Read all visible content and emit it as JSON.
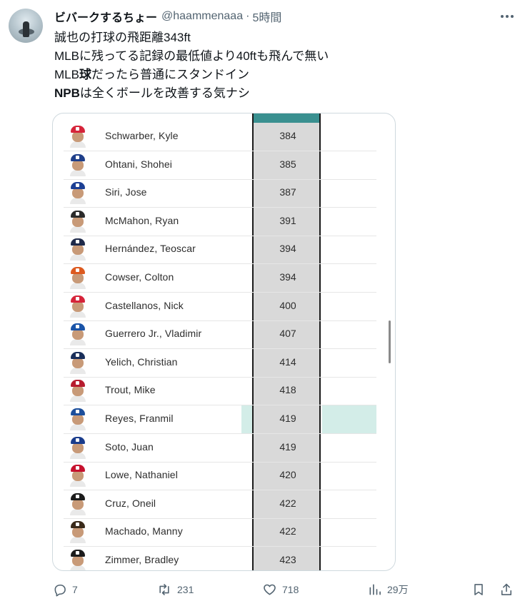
{
  "user": {
    "name": "ビバークするちょー",
    "handle": "@haammenaaa",
    "separator": "·",
    "time": "5時間"
  },
  "tweet": {
    "lines": [
      {
        "text": "誠也の打球の飛距離343ft"
      },
      {
        "text": "MLBに残ってる記録の最低値より40ftも飛んで無い"
      },
      {
        "pre": "MLB",
        "bold": "球",
        "post": "だったら普通にスタンドイン"
      },
      {
        "bold": "NPB",
        "post": "は全くボールを改善する気ナシ"
      }
    ]
  },
  "table": {
    "rows": [
      {
        "name": "Schwarber, Kyle",
        "value": "384",
        "cap": "#d6243a"
      },
      {
        "name": "Ohtani, Shohei",
        "value": "385",
        "cap": "#1f3f8a"
      },
      {
        "name": "Siri, Jose",
        "value": "387",
        "cap": "#1c3f94"
      },
      {
        "name": "McMahon, Ryan",
        "value": "391",
        "cap": "#2b2b2b"
      },
      {
        "name": "Hernández, Teoscar",
        "value": "394",
        "cap": "#1f2a4a"
      },
      {
        "name": "Cowser, Colton",
        "value": "394",
        "cap": "#dd5a1f"
      },
      {
        "name": "Castellanos, Nick",
        "value": "400",
        "cap": "#d6243a"
      },
      {
        "name": "Guerrero Jr., Vladimir",
        "value": "407",
        "cap": "#1a54a8"
      },
      {
        "name": "Yelich, Christian",
        "value": "414",
        "cap": "#1a2f5a"
      },
      {
        "name": "Trout, Mike",
        "value": "418",
        "cap": "#b71c2e"
      },
      {
        "name": "Reyes, Franmil",
        "value": "419",
        "cap": "#1d4f9c",
        "highlighted": true
      },
      {
        "name": "Soto, Juan",
        "value": "419",
        "cap": "#1a3c8c"
      },
      {
        "name": "Lowe, Nathaniel",
        "value": "420",
        "cap": "#c6112e"
      },
      {
        "name": "Cruz, Oneil",
        "value": "422",
        "cap": "#1c1c1c"
      },
      {
        "name": "Machado, Manny",
        "value": "422",
        "cap": "#3a2a1a"
      },
      {
        "name": "Zimmer, Bradley",
        "value": "423",
        "cap": "#1c1c1c"
      }
    ]
  },
  "actions": {
    "reply": {
      "icon": "reply-icon",
      "count": "7"
    },
    "repost": {
      "icon": "repost-icon",
      "count": "231"
    },
    "like": {
      "icon": "heart-icon",
      "count": "718"
    },
    "views": {
      "icon": "views-icon",
      "count": "29万"
    },
    "bookmark": {
      "icon": "bookmark-icon"
    },
    "share": {
      "icon": "share-icon"
    }
  },
  "colors": {
    "column_header": "#3a9090",
    "highlight_row": "#d3ede8",
    "secondary_text": "#536471"
  }
}
